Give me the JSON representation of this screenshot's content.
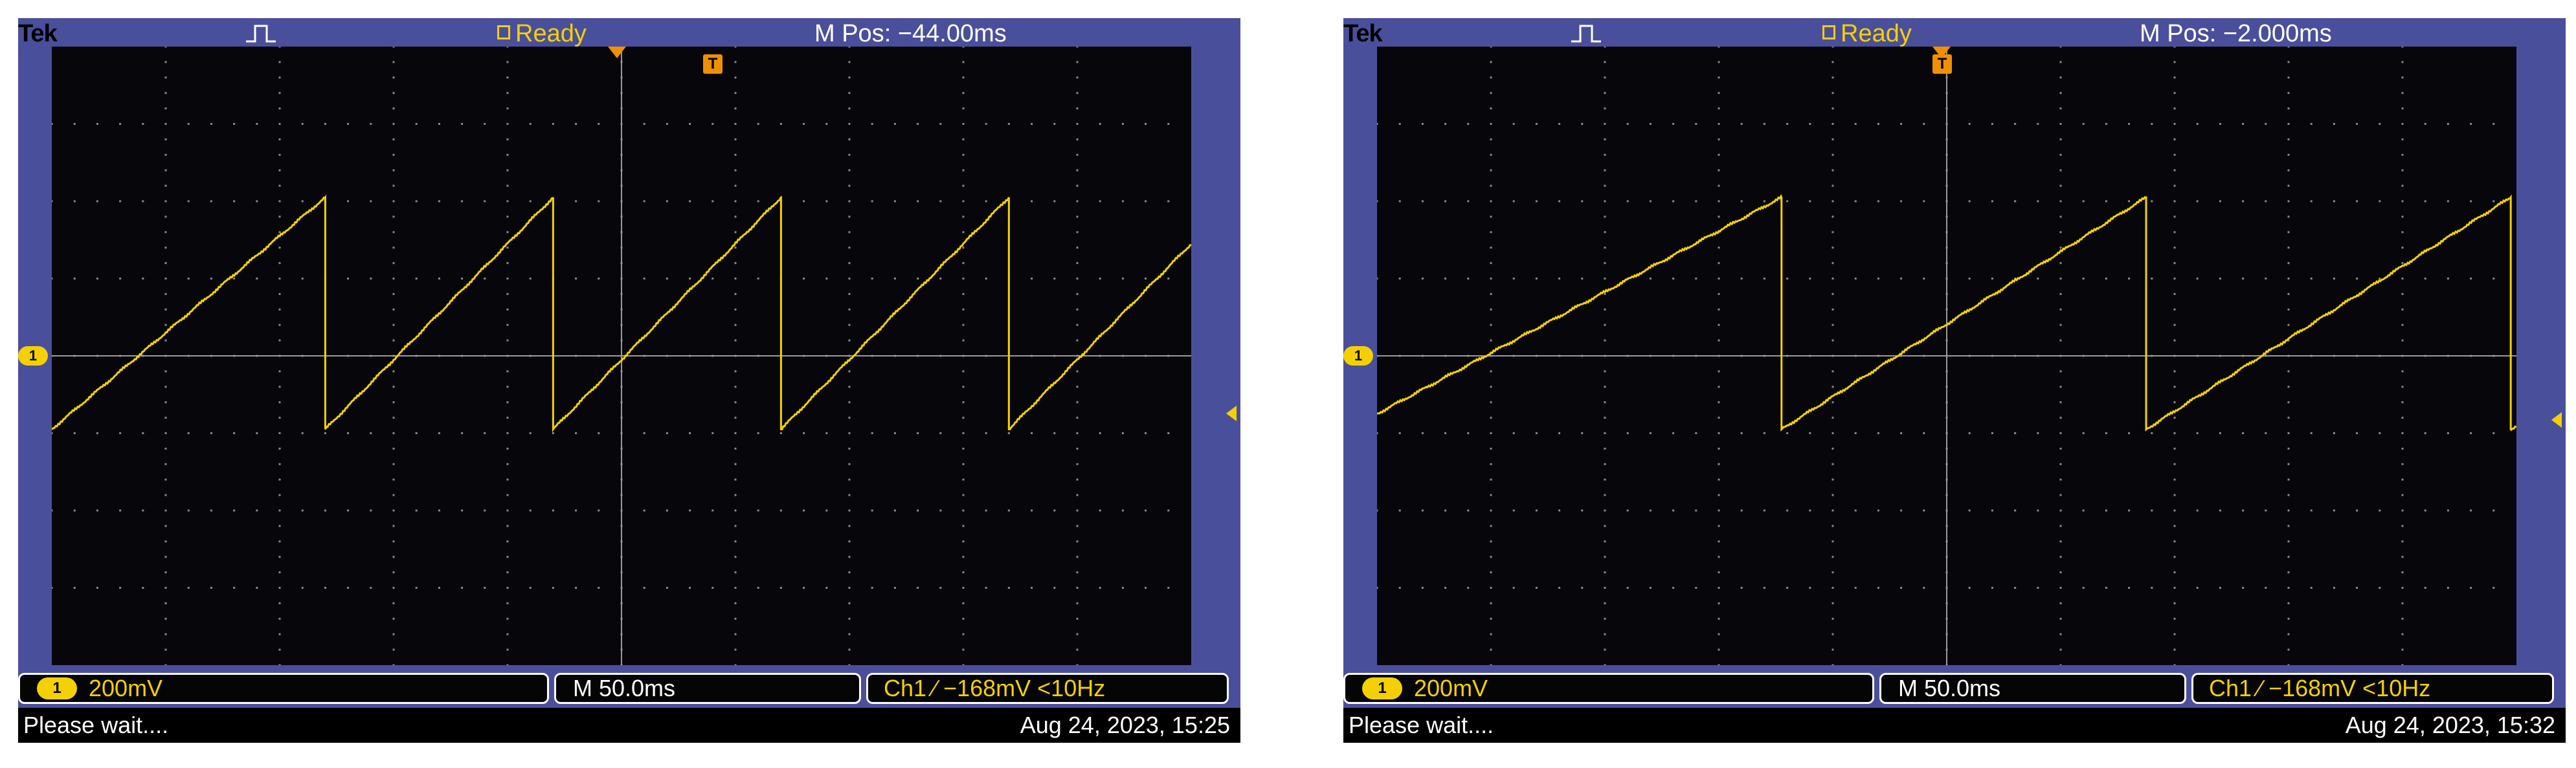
{
  "colors": {
    "frame": "#4a4f9c",
    "trace": "#f5d000",
    "trigger": "#f09000",
    "screen": "#07070b"
  },
  "screens": [
    {
      "brand": "Tek",
      "acq_icon": "pulse-icon",
      "status_label": "Ready",
      "m_pos": "M Pos: −44.00ms",
      "trigger_marker": "T",
      "ch_marker": "1",
      "scale": {
        "ch_label": "1",
        "volts": "200mV",
        "time": "M 50.0ms",
        "trigger": "Ch1 ∕ −168mV   <10Hz"
      },
      "message": "Please wait....",
      "datetime": "Aug 24, 2023, 15:25",
      "waveform": {
        "type": "sawtooth",
        "period_ms": 100,
        "amplitude_div_high": 2.05,
        "amplitude_div_low": -0.95,
        "ramp_start_div": -0.95
      }
    },
    {
      "brand": "Tek",
      "acq_icon": "pulse-icon",
      "status_label": "Ready",
      "m_pos": "M Pos: −2.000ms",
      "trigger_marker": "T",
      "ch_marker": "1",
      "scale": {
        "ch_label": "1",
        "volts": "200mV",
        "time": "M 50.0ms",
        "trigger": "Ch1 ∕ −168mV   <10Hz"
      },
      "message": "Please wait....",
      "datetime": "Aug 24, 2023, 15:32",
      "waveform": {
        "type": "sawtooth",
        "period_ms": 160,
        "amplitude_div_high": 2.05,
        "amplitude_div_low": -0.95,
        "ramp_start_div": -0.75
      }
    }
  ]
}
